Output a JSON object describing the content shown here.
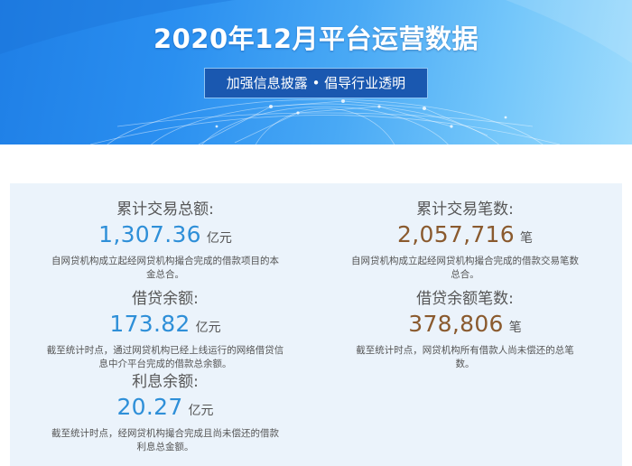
{
  "header": {
    "title": "2020年12月平台运营数据",
    "subtitle": "加强信息披露 • 倡导行业透明"
  },
  "stats": {
    "total_amount": {
      "label": "累计交易总额:",
      "value": "1,307.36",
      "unit": "亿元",
      "desc": "自网贷机构成立起经网贷机构撮合完成的借款项目的本金总合。"
    },
    "total_count": {
      "label": "累计交易笔数:",
      "value": "2,057,716",
      "unit": "笔",
      "desc": "自网贷机构成立起经网贷机构撮合完成的借款交易笔数总合。"
    },
    "loan_balance": {
      "label": "借贷余额:",
      "value": "173.82",
      "unit": "亿元",
      "desc": "截至统计时点，通过网贷机构已经上线运行的网络借贷信息中介平台完成的借款总余额。"
    },
    "loan_balance_count": {
      "label": "借贷余额笔数:",
      "value": "378,806",
      "unit": "笔",
      "desc": "截至统计时点，网贷机构所有借款人尚未偿还的总笔数。"
    },
    "interest_balance": {
      "label": "利息余额:",
      "value": "20.27",
      "unit": "亿元",
      "desc": "截至统计时点，经网贷机构撮合完成且尚未偿还的借款利息总金额。"
    }
  },
  "colors": {
    "banner_primary": "#2a8ff0",
    "subtitle_box": "#1a58b0",
    "panel_bg": "#ebf3fb",
    "amount_blue": "#2e8fd8",
    "count_brown": "#8a5a2e"
  }
}
